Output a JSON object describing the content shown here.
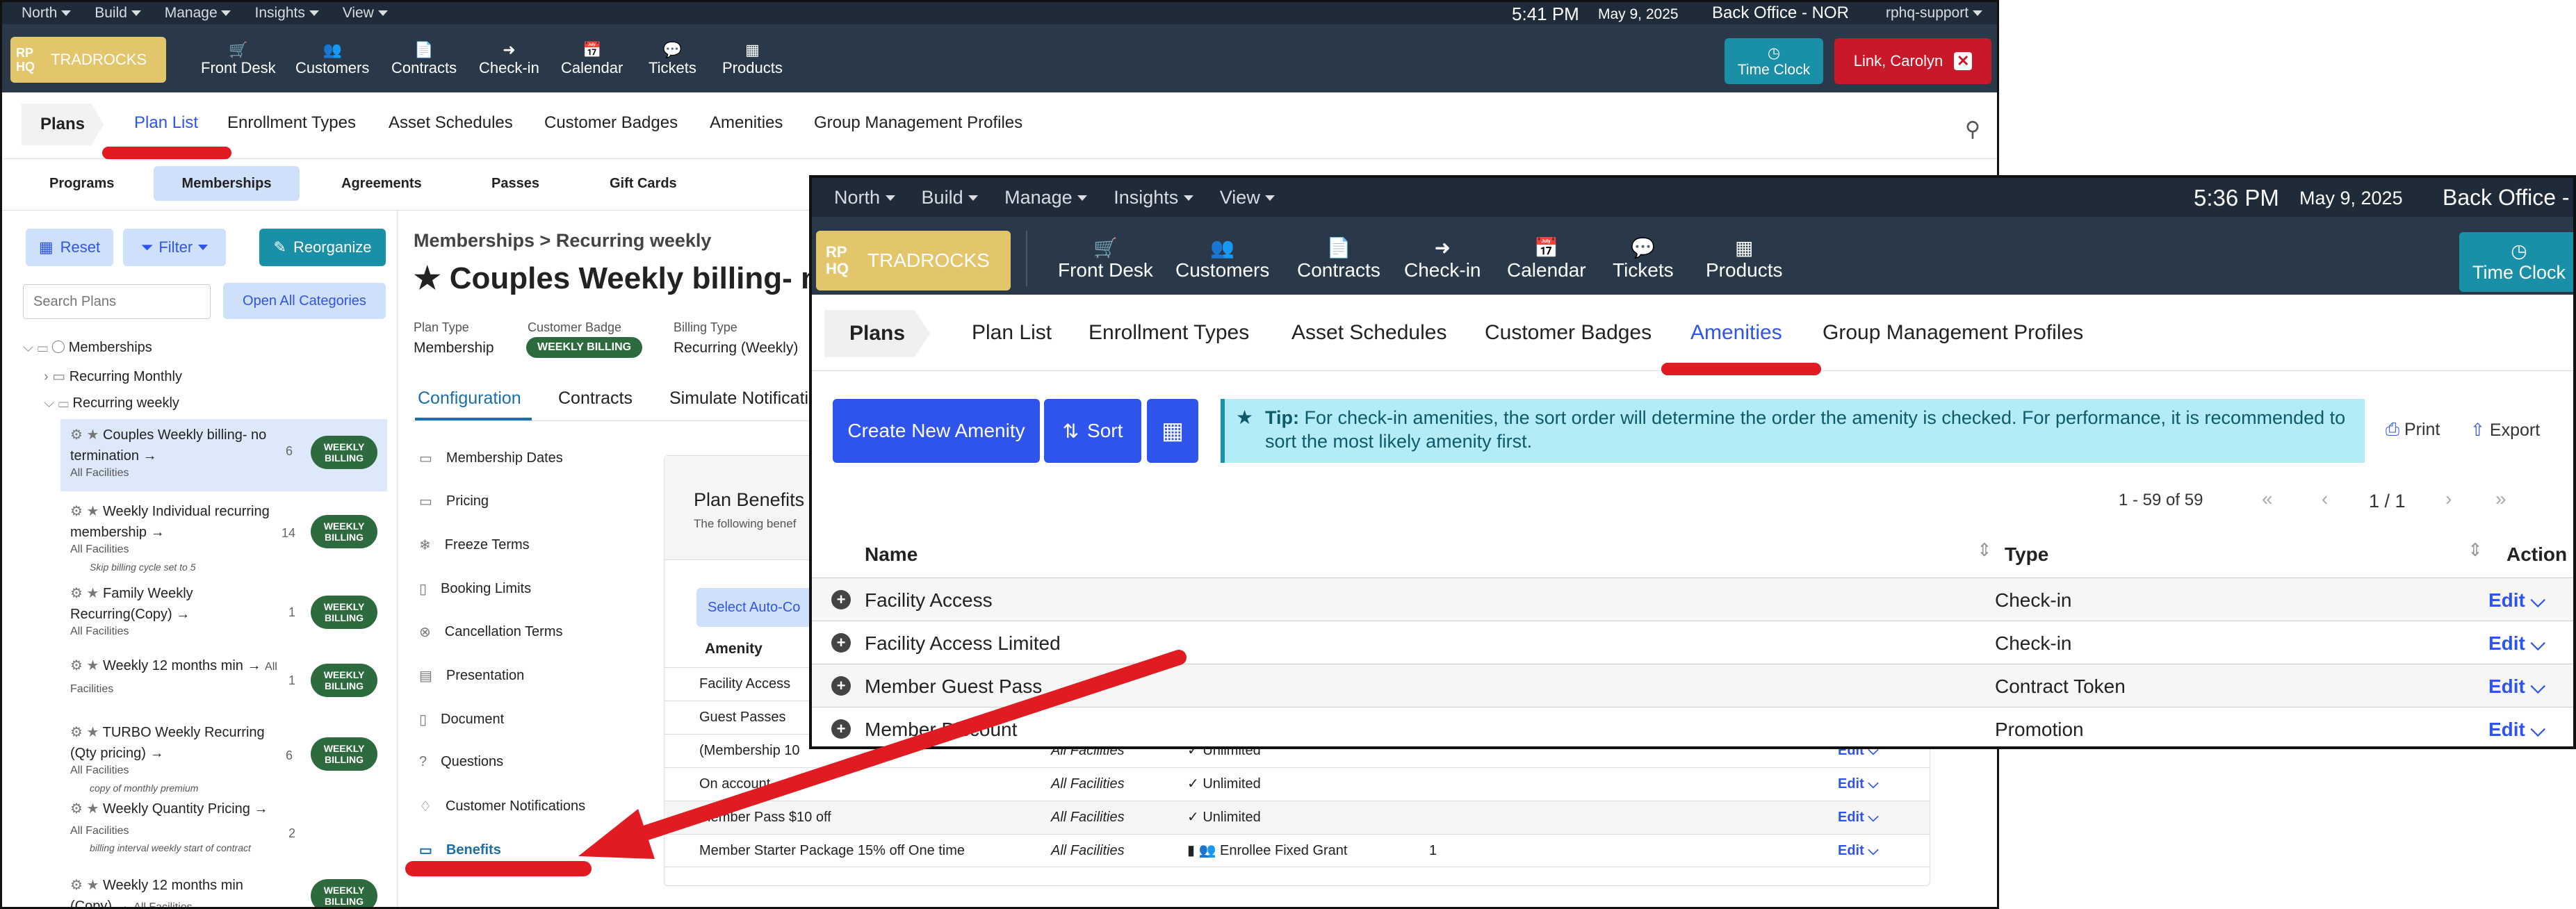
{
  "back": {
    "topbar": {
      "menus": [
        "North",
        "Build",
        "Manage",
        "Insights",
        "View"
      ],
      "time": "5:41 PM",
      "date": "May 9, 2025",
      "office": "Back Office - NOR",
      "user": "rphq-support"
    },
    "logo": {
      "mark": "RP HQ",
      "text": "TRADROCKS"
    },
    "nav": [
      "Front Desk",
      "Customers",
      "Contracts",
      "Check-in",
      "Calendar",
      "Tickets",
      "Products"
    ],
    "time_clock": "Time Clock",
    "user_btn": "Link, Carolyn",
    "plans_label": "Plans",
    "tabs": [
      "Plan List",
      "Enrollment Types",
      "Asset Schedules",
      "Customer Badges",
      "Amenities",
      "Group Management Profiles"
    ],
    "subtabs": [
      "Programs",
      "Memberships",
      "Agreements",
      "Passes",
      "Gift Cards"
    ],
    "reset": "Reset",
    "filter": "Filter",
    "reorganize": "Reorganize",
    "search_placeholder": "Search Plans",
    "open_all": "Open All Categories",
    "tree": {
      "root": "Memberships",
      "monthly": "Recurring Monthly",
      "weekly": "Recurring weekly"
    },
    "plans": [
      {
        "name": "Couples Weekly billing- no termination",
        "suffix": "All Facilities",
        "note": "",
        "count": "6",
        "badge": "WEEKLY BILLING"
      },
      {
        "name": "Weekly Individual recurring membership",
        "suffix": "All Facilities",
        "note": "Skip billing cycle set to 5",
        "count": "14",
        "badge": "WEEKLY BILLING"
      },
      {
        "name": "Family Weekly Recurring(Copy)",
        "suffix": "All Facilities",
        "note": "",
        "count": "1",
        "badge": "WEEKLY BILLING"
      },
      {
        "name": "Weekly 12 months min",
        "suffix": "All Facilities",
        "note": "",
        "count": "1",
        "badge": "WEEKLY BILLING"
      },
      {
        "name": "TURBO Weekly Recurring (Qty pricing)",
        "suffix": "All Facilities",
        "note": "copy of monthly premium",
        "count": "6",
        "badge": "WEEKLY BILLING"
      },
      {
        "name": "Weekly Quantity Pricing",
        "suffix": "All Facilities",
        "note": "billing interval weekly start of contract",
        "count": "2",
        "badge": ""
      },
      {
        "name": "Weekly 12 months min (Copy)",
        "suffix": "All Facilities",
        "note": "",
        "count": "",
        "badge": "WEEKLY BILLING"
      }
    ],
    "breadcrumb": "Memberships > Recurring weekly",
    "plan_title": "Couples Weekly billing- no t",
    "meta": {
      "plan_type_label": "Plan Type",
      "plan_type": "Membership",
      "badge_label": "Customer Badge",
      "badge": "WEEKLY BILLING",
      "billing_label": "Billing Type",
      "billing": "Recurring (Weekly)"
    },
    "detail_tabs": [
      "Configuration",
      "Contracts",
      "Simulate Notificati"
    ],
    "side_menu": [
      "Membership Dates",
      "Pricing",
      "Freeze Terms",
      "Booking Limits",
      "Cancellation Terms",
      "Presentation",
      "Document",
      "Questions",
      "Customer Notifications",
      "Benefits"
    ],
    "plan_benefits": {
      "title": "Plan Benefits",
      "subtitle": "The following benef",
      "select_btn": "Select Auto-Co",
      "col_amenity": "Amenity"
    },
    "benefits": [
      {
        "name": "Facility Access",
        "fac": "",
        "qty": "",
        "edit": ""
      },
      {
        "name": "Guest Passes",
        "fac": "",
        "qty": "",
        "edit": ""
      },
      {
        "name": "(Membership 10",
        "fac": "All Facilities",
        "qty": "Unlimited",
        "edit": "Edit"
      },
      {
        "name": "On account",
        "fac": "All Facilities",
        "qty": "Unlimited",
        "edit": "Edit"
      },
      {
        "name": "Member Pass $10 off",
        "fac": "All Facilities",
        "qty": "Unlimited",
        "edit": "Edit"
      },
      {
        "name": "Member Starter Package 15% off One time",
        "fac": "All Facilities",
        "qty": "Enrollee Fixed Grant",
        "extra": "1",
        "edit": "Edit"
      }
    ]
  },
  "front": {
    "topbar": {
      "menus": [
        "North",
        "Build",
        "Manage",
        "Insights",
        "View"
      ],
      "time": "5:36 PM",
      "date": "May 9, 2025",
      "office": "Back Office - I"
    },
    "logo": {
      "mark": "RP HQ",
      "text": "TRADROCKS"
    },
    "nav": [
      "Front Desk",
      "Customers",
      "Contracts",
      "Check-in",
      "Calendar",
      "Tickets",
      "Products"
    ],
    "time_clock": "Time Clock",
    "plans_label": "Plans",
    "tabs": [
      "Plan List",
      "Enrollment Types",
      "Asset Schedules",
      "Customer Badges",
      "Amenities",
      "Group Management Profiles"
    ],
    "create_btn": "Create New Amenity",
    "sort_btn": "Sort",
    "tip_label": "Tip:",
    "tip_text": "For check-in amenities, the sort order will determine the order the amenity is checked. For performance, it is recommended to sort the most likely amenity first.",
    "print": "Print",
    "export": "Export",
    "pagination": {
      "range": "1 - 59 of 59",
      "page": "1 / 1"
    },
    "columns": {
      "name": "Name",
      "type": "Type",
      "action": "Action"
    },
    "rows": [
      {
        "name": "Facility Access",
        "type": "Check-in",
        "edit": "Edit"
      },
      {
        "name": "Facility Access Limited",
        "type": "Check-in",
        "edit": "Edit"
      },
      {
        "name": "Member Guest Pass",
        "type": "Contract Token",
        "edit": "Edit"
      },
      {
        "name": "Member Discount",
        "type": "Promotion",
        "edit": "Edit"
      }
    ]
  },
  "colors": {
    "accent": "#2f54eb",
    "red": "#e11b22",
    "nav": "#29394a",
    "top": "#1f2b38",
    "teal": "#1a8fa8",
    "logo": "#e3c56b",
    "badge": "#2d6a3e",
    "tip": "#b3ecf7"
  }
}
